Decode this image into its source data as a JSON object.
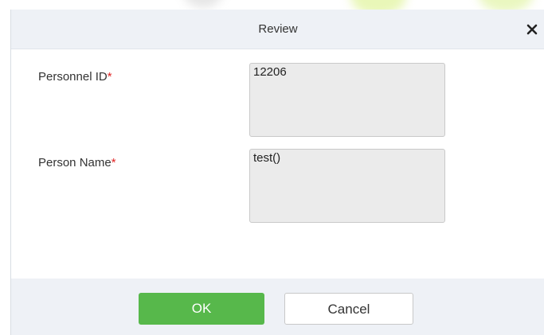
{
  "dialog": {
    "title": "Review",
    "close_icon": "close-icon"
  },
  "form": {
    "personnel_id": {
      "label": "Personnel ID",
      "required_mark": "*",
      "value": "12206"
    },
    "person_name": {
      "label": "Person Name",
      "required_mark": "*",
      "value": "test()"
    }
  },
  "footer": {
    "ok_label": "OK",
    "cancel_label": "Cancel"
  },
  "colors": {
    "ok_button": "#57b84b",
    "required": "#e02424",
    "header_bg": "#eef1f6"
  }
}
